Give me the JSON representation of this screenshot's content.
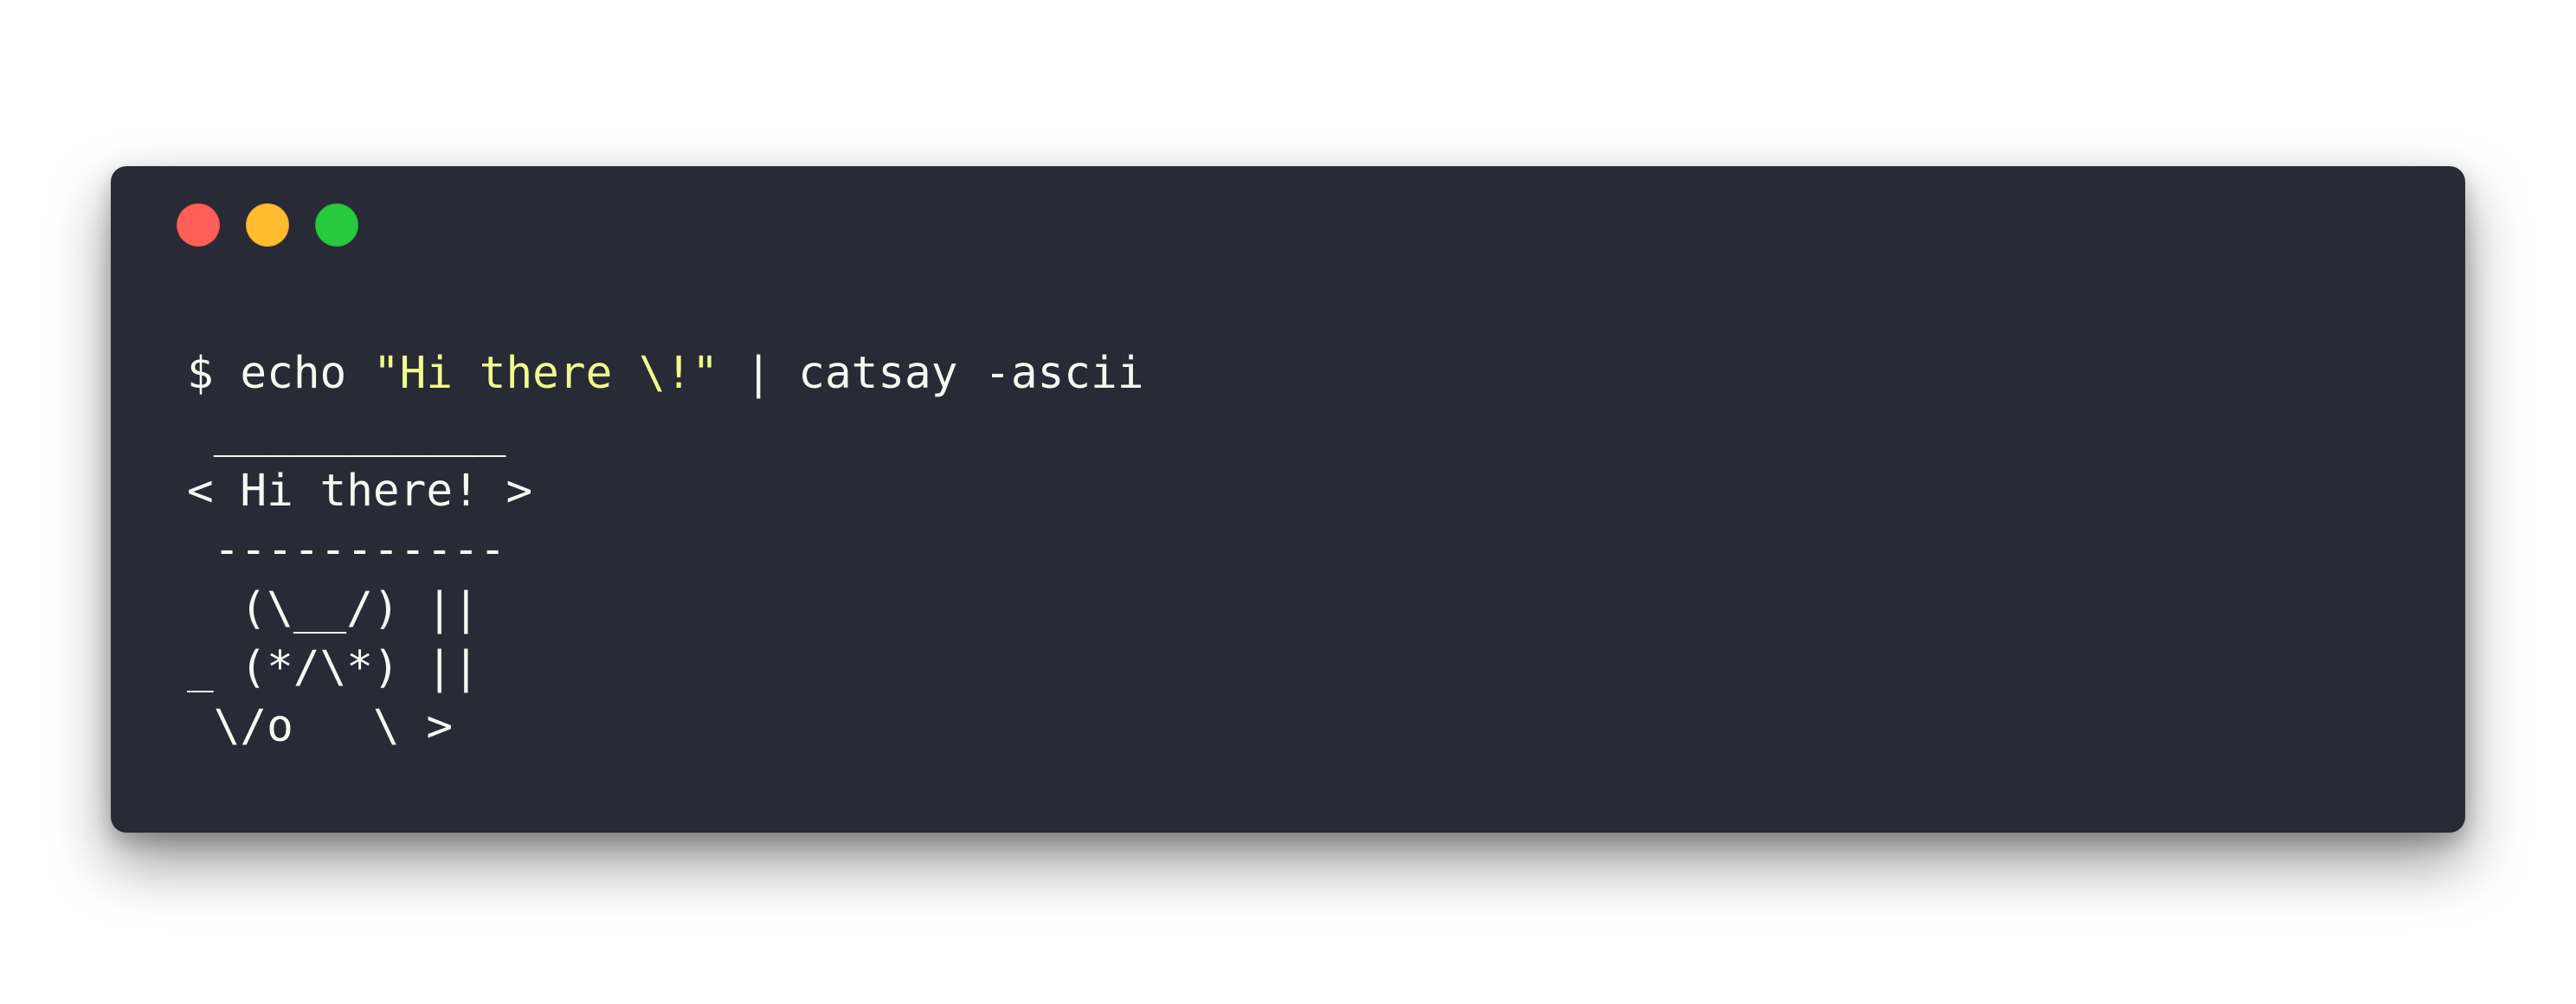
{
  "window": {
    "buttons": [
      {
        "name": "close",
        "color": "#ff5f56"
      },
      {
        "name": "minimize",
        "color": "#ffbd2e"
      },
      {
        "name": "maximize",
        "color": "#27c93f"
      }
    ]
  },
  "command": {
    "prompt": "$ ",
    "cmd": "echo ",
    "arg": "\"Hi there \\!\"",
    "rest": " | catsay -ascii"
  },
  "output": {
    "lines": [
      " ___________",
      "< Hi there! >",
      " -----------",
      "  (\\__/) ||",
      "_ (*/\\*) ||",
      " \\/o   \\ >"
    ]
  },
  "colors": {
    "background": "#282a36",
    "foreground": "#f8f8f2",
    "string": "#f1fa8c"
  }
}
